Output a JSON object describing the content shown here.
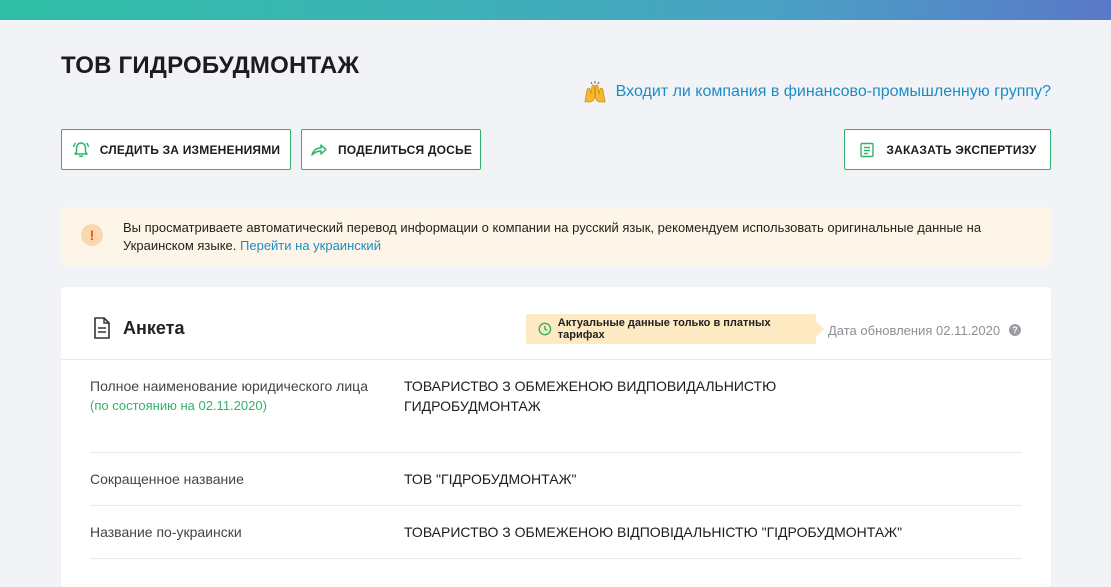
{
  "header": {
    "company_name": "ТОВ ГИДРОБУДМОНТАЖ",
    "fig_question": "Входит ли компания в финансово-промышленную группу?"
  },
  "actions": {
    "follow_label": "СЛЕДИТЬ ЗА ИЗМЕНЕНИЯМИ",
    "share_label": "ПОДЕЛИТЬСЯ ДОСЬЕ",
    "expert_label": "ЗАКАЗАТЬ ЭКСПЕРТИЗУ"
  },
  "notice": {
    "icon_text": "!",
    "text": "Вы просматриваете автоматический перевод информации о компании на русский язык, рекомендуем использовать оригинальные данные на Украинском языке. ",
    "link_label": "Перейти на украинский"
  },
  "anketa": {
    "title": "Анкета",
    "paid_badge": "Актуальные данные только в платных тарифах",
    "update_date": "Дата обновления 02.11.2020",
    "help_text": "?",
    "rows": [
      {
        "label": "Полное наименование юридического лица",
        "sub": "(по состоянию на 02.11.2020)",
        "value": "ТОВАРИСТВО З ОБМЕЖЕНОЮ ВИДПОВИДАЛЬНИСТЮ ГИДРОБУДМОНТАЖ"
      },
      {
        "label": "Сокращенное название",
        "value": "ТОВ \"ГІДРОБУДМОНТАЖ\""
      },
      {
        "label": "Название по-украински",
        "value": "ТОВАРИСТВО З ОБМЕЖЕНОЮ ВІДПОВІДАЛЬНІСТЮ \"ГІДРОБУДМОНТАЖ\""
      }
    ]
  },
  "colors": {
    "accent_green": "#2fb36b",
    "link_blue": "#1a8dc8",
    "notice_bg": "#fdf6e8",
    "badge_bg": "#fde9c2"
  },
  "icons": [
    "raised-hands-icon",
    "bell-icon",
    "share-arrow-icon",
    "checklist-icon",
    "exclamation-icon",
    "document-icon",
    "clock-icon",
    "question-icon"
  ]
}
